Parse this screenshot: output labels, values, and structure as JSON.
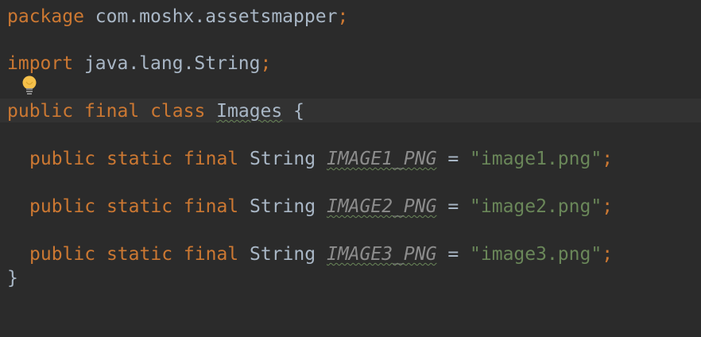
{
  "code": {
    "line1": {
      "keyword": "package",
      "package_name": " com.moshx.assetsmapper",
      "semicolon": ";"
    },
    "line2": {
      "keyword": "import",
      "import_name": " java.lang.String",
      "semicolon": ";"
    },
    "line3": {
      "kw_public": "public",
      "kw_final": "final",
      "kw_class": "class",
      "class_name": "Images",
      "brace_open": "{"
    },
    "fields": [
      {
        "kw_public": "public",
        "kw_static": "static",
        "kw_final": "final",
        "type": "String",
        "name": "IMAGE1_PNG",
        "equals": "=",
        "value": "\"image1.png\"",
        "semicolon": ";"
      },
      {
        "kw_public": "public",
        "kw_static": "static",
        "kw_final": "final",
        "type": "String",
        "name": "IMAGE2_PNG",
        "equals": "=",
        "value": "\"image2.png\"",
        "semicolon": ";"
      },
      {
        "kw_public": "public",
        "kw_static": "static",
        "kw_final": "final",
        "type": "String",
        "name": "IMAGE3_PNG",
        "equals": "=",
        "value": "\"image3.png\"",
        "semicolon": ";"
      }
    ],
    "brace_close": "}"
  },
  "icons": {
    "intention": "lightbulb-icon"
  },
  "colors": {
    "background": "#2b2b2b",
    "current_line": "#323232",
    "keyword": "#cc7832",
    "text": "#a9b7c6",
    "string": "#6a8759",
    "constant": "#8c8c8c",
    "bulb": "#f5c04a"
  }
}
